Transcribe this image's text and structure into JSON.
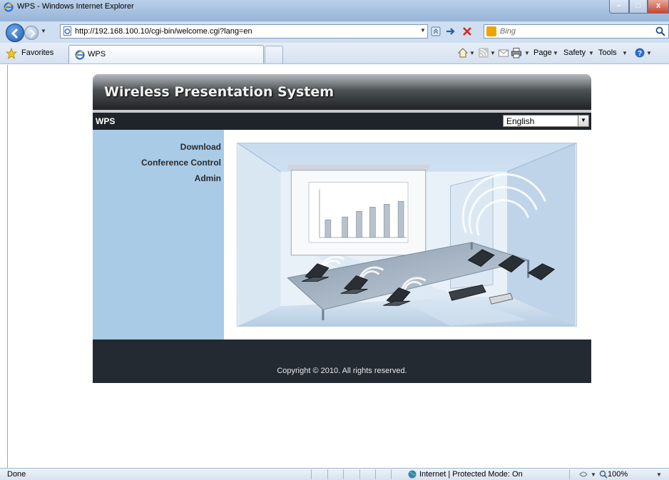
{
  "window": {
    "title": "WPS - Windows Internet Explorer",
    "minimize_label": "–",
    "maximize_label": "□",
    "close_label": "x"
  },
  "address": {
    "url": "http://192.168.100.10/cgi-bin/welcome.cgi?lang=en"
  },
  "search": {
    "placeholder": "Bing"
  },
  "favorites": {
    "label": "Favorites"
  },
  "tab": {
    "label": "WPS"
  },
  "command_bar": {
    "page": "Page",
    "safety": "Safety",
    "tools": "Tools"
  },
  "wps": {
    "header_title": "Wireless Presentation System",
    "nav_label": "WPS",
    "language": {
      "selected": "English",
      "arrow": "▼"
    },
    "sidebar": [
      {
        "label": "Download"
      },
      {
        "label": "Conference Control"
      },
      {
        "label": "Admin"
      }
    ],
    "footer": "Copyright © 2010. All rights reserved."
  },
  "status": {
    "text": "Done",
    "zone": "Internet | Protected Mode: On",
    "zoom": "100%"
  },
  "icons": {
    "back": "back-arrow-icon",
    "forward": "forward-arrow-icon",
    "refresh": "compatibility-view-icon",
    "go": "go-arrow-icon",
    "stop": "stop-icon",
    "search": "search-icon",
    "favorites": "favorites-star-icon",
    "home": "home-icon",
    "feeds": "rss-feeds-icon",
    "mail": "read-mail-icon",
    "print": "print-icon",
    "help": "help-icon",
    "zone": "internet-globe-icon"
  }
}
